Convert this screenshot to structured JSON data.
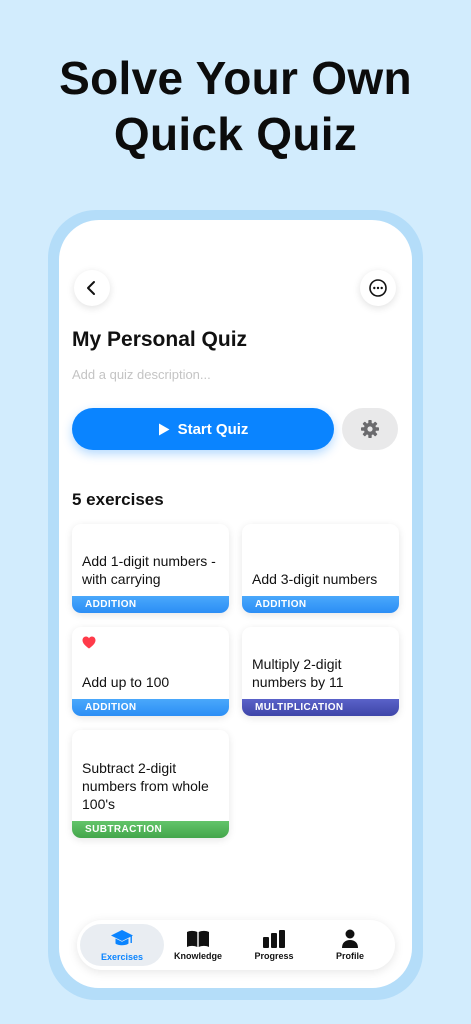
{
  "headline": {
    "line1": "Solve Your Own",
    "line2": "Quick Quiz"
  },
  "quiz": {
    "title": "My Personal Quiz",
    "description_placeholder": "Add a quiz description...",
    "start_label": "Start Quiz",
    "exercise_count": "5 exercises"
  },
  "exercises": [
    {
      "title": "Add 1-digit numbers - with carrying",
      "category": "ADDITION",
      "favorite": false
    },
    {
      "title": "Add 3-digit numbers",
      "category": "ADDITION",
      "favorite": false
    },
    {
      "title": "Add up to 100",
      "category": "ADDITION",
      "favorite": true
    },
    {
      "title": "Multiply 2-digit numbers by 11",
      "category": "MULTIPLICATION",
      "favorite": false
    },
    {
      "title": "Subtract 2-digit numbers from whole 100's",
      "category": "SUBTRACTION",
      "favorite": false
    }
  ],
  "tabs": [
    {
      "label": "Exercises",
      "icon": "graduation-cap-icon",
      "active": true
    },
    {
      "label": "Knowledge",
      "icon": "book-icon",
      "active": false
    },
    {
      "label": "Progress",
      "icon": "bar-chart-icon",
      "active": false
    },
    {
      "label": "Profile",
      "icon": "person-icon",
      "active": false
    }
  ],
  "colors": {
    "accent": "#0a84ff",
    "background": "#d2ecfd",
    "addition": "#2b8ef5",
    "multiplication": "#3e45a8",
    "subtraction": "#43a64b",
    "heart": "#ff3b4a"
  }
}
